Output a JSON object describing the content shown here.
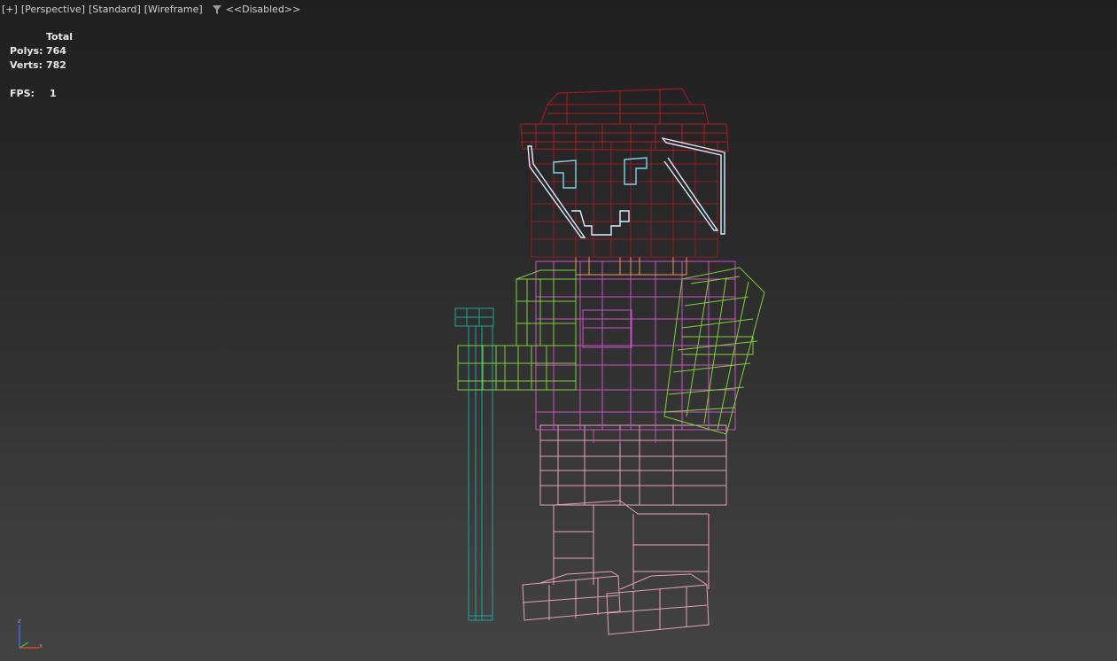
{
  "viewport": {
    "labels": [
      "[+]",
      "[Perspective]",
      "[Standard]",
      "[Wireframe]"
    ],
    "filter_icon": "funnel-filter-icon",
    "filter_text": "<<Disabled>>"
  },
  "stats": {
    "header": "Total",
    "polys_label": "Polys:",
    "polys_value": "764",
    "verts_label": "Verts:",
    "verts_value": "782",
    "fps_label": "FPS:",
    "fps_value": "1"
  },
  "axis_gizmo": {
    "z": "z",
    "x": "x"
  },
  "colors": {
    "hat": "#b01a22",
    "face": "#8e1e24",
    "eyebrows": "#d6f0ff",
    "eyes": "#7fd6ea",
    "body": "#c851c4",
    "arms": "#7fcf3a",
    "legs": "#e4a0b8",
    "staff": "#1ea59a",
    "neck": "#f09a5a"
  }
}
